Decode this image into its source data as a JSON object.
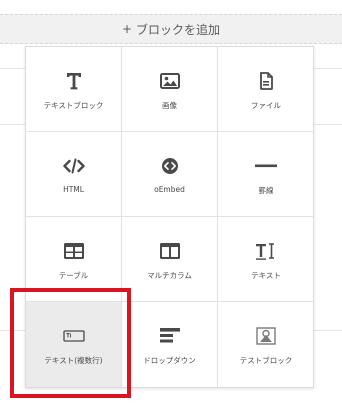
{
  "add_bar": {
    "plus": "+",
    "label": "ブロックを追加"
  },
  "blocks": [
    {
      "label": "テキストブロック",
      "icon": "text-T-icon"
    },
    {
      "label": "画像",
      "icon": "image-icon"
    },
    {
      "label": "ファイル",
      "icon": "file-icon"
    },
    {
      "label": "HTML",
      "icon": "code-icon"
    },
    {
      "label": "oEmbed",
      "icon": "embed-icon"
    },
    {
      "label": "罫線",
      "icon": "horizontal-rule-icon"
    },
    {
      "label": "テーブル",
      "icon": "table-icon"
    },
    {
      "label": "マルチカラム",
      "icon": "columns-icon"
    },
    {
      "label": "テキスト",
      "icon": "text-input-icon"
    },
    {
      "label": "テキスト(複数行)",
      "icon": "textarea-icon",
      "selected": true
    },
    {
      "label": "ドロップダウン",
      "icon": "dropdown-icon"
    },
    {
      "label": "テストブロック",
      "icon": "test-block-icon"
    }
  ],
  "colors": {
    "highlight": "#d9161f",
    "icon": "#4a4a4a",
    "selected_bg": "#ebebeb"
  }
}
